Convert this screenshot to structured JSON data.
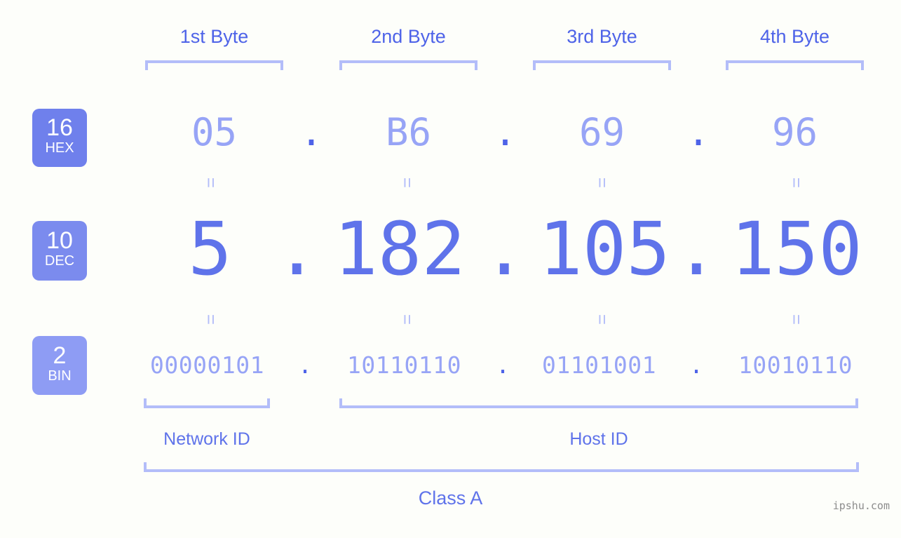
{
  "background_color": "#fdfefa",
  "accent_colors": {
    "strong_blue": "#4e63e8",
    "medium_blue": "#5f73ea",
    "light_blue": "#97a4f6",
    "bracket_blue": "#b3bdf9",
    "badge_hex": "#6f80ec",
    "badge_dec": "#7b8bee",
    "badge_bin": "#8e9cf4",
    "watermark_gray": "#8c8c8c"
  },
  "byte_headers": [
    {
      "label": "1st Byte"
    },
    {
      "label": "2nd Byte"
    },
    {
      "label": "3rd Byte"
    },
    {
      "label": "4th Byte"
    }
  ],
  "bases": [
    {
      "number": "16",
      "abbr": "HEX"
    },
    {
      "number": "10",
      "abbr": "DEC"
    },
    {
      "number": "2",
      "abbr": "BIN"
    }
  ],
  "rows": {
    "hex": {
      "base_number": "16",
      "base_abbr": "HEX",
      "values": [
        "05",
        "B6",
        "69",
        "96"
      ],
      "separator": "."
    },
    "dec": {
      "base_number": "10",
      "base_abbr": "DEC",
      "values": [
        "5",
        "182",
        "105",
        "150"
      ],
      "separator": "."
    },
    "bin": {
      "base_number": "2",
      "base_abbr": "BIN",
      "values": [
        "00000101",
        "10110110",
        "01101001",
        "10010110"
      ],
      "separator": "."
    }
  },
  "equals_separator": "=",
  "sections": {
    "network_id": "Network ID",
    "host_id": "Host ID",
    "class": "Class A"
  },
  "watermark": "ipshu.com"
}
